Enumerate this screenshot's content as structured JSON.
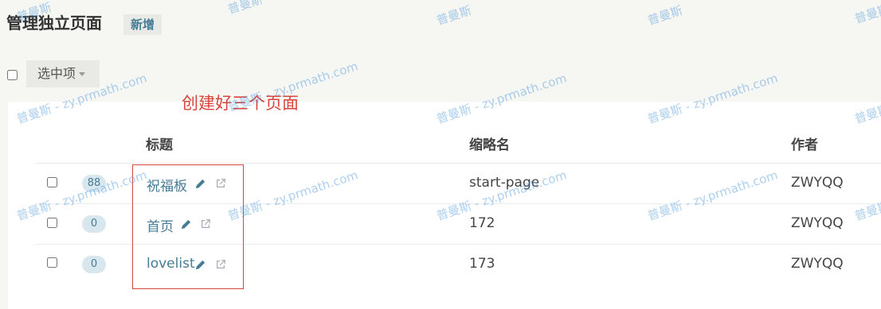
{
  "header": {
    "title": "管理独立页面",
    "add_label": "新增"
  },
  "bulk": {
    "dropdown_label": "选中项"
  },
  "annotation": {
    "text": "创建好三个页面",
    "color": "#d9463b"
  },
  "table": {
    "columns": [
      "标题",
      "缩略名",
      "作者"
    ],
    "rows": [
      {
        "comments": "88",
        "title": "祝福板",
        "slug": "start-page",
        "author": "ZWYQQ"
      },
      {
        "comments": "0",
        "title": "首页",
        "slug": "172",
        "author": "ZWYQQ"
      },
      {
        "comments": "0",
        "title": "lovelist",
        "slug": "173",
        "author": "ZWYQQ"
      }
    ]
  },
  "watermark": {
    "short": "普曼斯",
    "full": "普曼斯 - zy.prmath.com"
  },
  "colors": {
    "link": "#467b96",
    "badge_bg": "#d8e7ee",
    "background": "#f6f6f3"
  }
}
